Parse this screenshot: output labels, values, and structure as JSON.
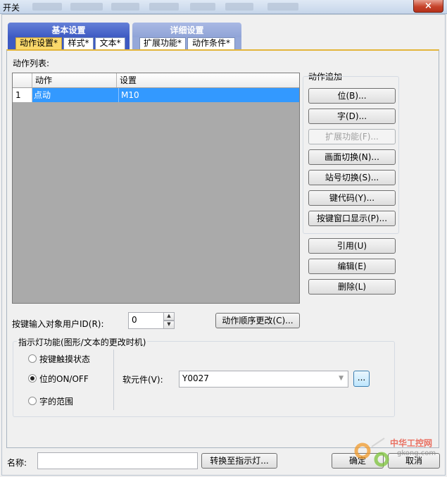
{
  "window": {
    "title": "开关",
    "close_icon": "×"
  },
  "group_tabs": {
    "basic": "基本设置",
    "detail": "详细设置"
  },
  "sub_tabs": [
    "动作设置*",
    "样式*",
    "文本*",
    "扩展功能*",
    "动作条件*"
  ],
  "action_list": {
    "label": "动作列表:",
    "columns": [
      "动作",
      "设置"
    ],
    "rows": [
      {
        "num": "1",
        "action": "点动",
        "setting": "M10"
      }
    ]
  },
  "action_add": {
    "label": "动作追加",
    "buttons": [
      "位(B)...",
      "字(D)...",
      "扩展功能(F)...",
      "画面切换(N)...",
      "站号切换(S)...",
      "键代码(Y)...",
      "按键窗口显示(P)..."
    ],
    "disabled_index": 2
  },
  "edit_buttons": [
    "引用(U)",
    "编辑(E)",
    "删除(L)"
  ],
  "user_id": {
    "label": "按键输入对象用户ID(R):",
    "value": "0"
  },
  "order_button": "动作顺序更改(C)...",
  "indicator": {
    "label": "指示灯功能(图形/文本的更改时机)",
    "options": [
      "按键触摸状态",
      "位的ON/OFF",
      "字的范围"
    ],
    "selected_index": 1,
    "device_label": "软元件(V):",
    "device_value": "Y0027",
    "browse_label": "..."
  },
  "footer": {
    "name_label": "名称:",
    "name_value": "",
    "convert_button": "转换至指示灯...",
    "ok_button": "确定",
    "cancel_button": "取消"
  },
  "watermark": {
    "text": "中华工控网",
    "domain": "gkong.com"
  }
}
